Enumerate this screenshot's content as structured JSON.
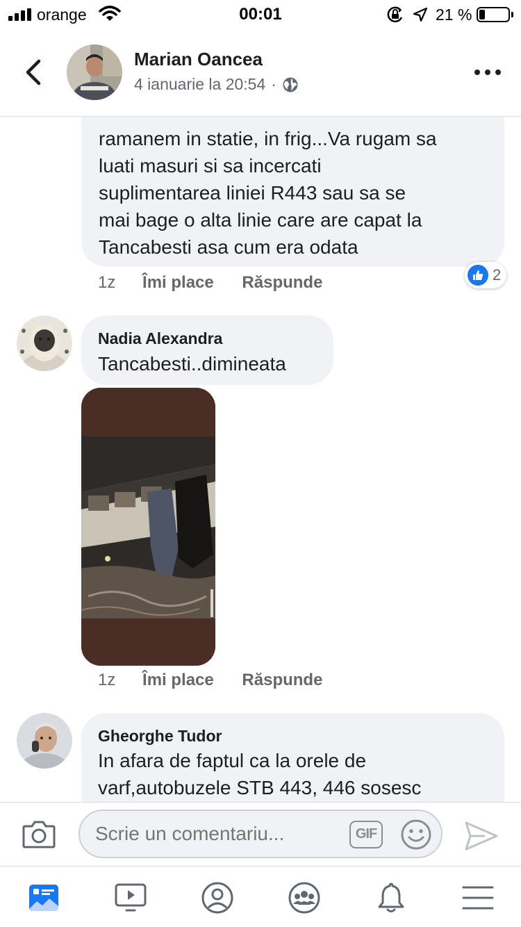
{
  "status_bar": {
    "carrier": "orange",
    "time": "00:01",
    "battery_percent": "21 %",
    "battery_level": 0.21
  },
  "header": {
    "author": "Marian Oancea",
    "date": "4 ianuarie la 20:54",
    "separator": "·",
    "audience_icon": "globe-icon"
  },
  "comments": [
    {
      "text_lines": [
        "ramanem in statie, in frig...Va rugam sa",
        "luati masuri si sa incercati",
        "suplimentarea liniei R443 sau sa se",
        "mai bage o alta linie care are capat la",
        "Tancabesti asa cum era odata"
      ],
      "time": "1z",
      "like_label": "Îmi place",
      "reply_label": "Răspunde",
      "reaction_count": "2"
    },
    {
      "name": "Nadia Alexandra",
      "text": "Tancabesti..dimineata",
      "time": "1z",
      "like_label": "Îmi place",
      "reply_label": "Răspunde"
    },
    {
      "name": "Gheorghe Tudor",
      "text_lines": [
        "In afara de faptul ca la orele de",
        "varf,autobuzele STB 443, 446 sosesc"
      ]
    }
  ],
  "composer": {
    "placeholder": "Scrie un comentariu...",
    "gif_label": "GIF"
  },
  "tabs": [
    "news-feed",
    "watch",
    "profile",
    "groups",
    "notifications",
    "menu"
  ],
  "colors": {
    "accent": "#1877f2",
    "bubble": "#f0f2f5",
    "muted_text": "#65676b"
  }
}
